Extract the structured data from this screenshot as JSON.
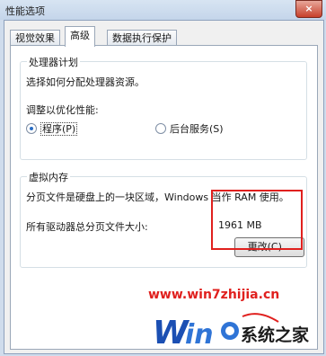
{
  "window": {
    "title": "性能选项",
    "close_glyph": "×"
  },
  "tabs": [
    {
      "label": "视觉效果",
      "active": false
    },
    {
      "label": "高级",
      "active": true
    },
    {
      "label": "数据执行保护",
      "active": false
    }
  ],
  "cpu_scheduling": {
    "legend": "处理器计划",
    "description": "选择如何分配处理器资源。",
    "adjust_label": "调整以优化性能:",
    "options": [
      {
        "label": "程序(P)",
        "selected": true
      },
      {
        "label": "后台服务(S)",
        "selected": false
      }
    ]
  },
  "virtual_memory": {
    "legend": "虚拟内存",
    "description": "分页文件是硬盘上的一块区域，Windows 当作 RAM 使用。",
    "total_label": "所有驱动器总分页文件大小:",
    "total_value": "1961 MB",
    "change_button": "更改(C)..."
  },
  "watermark": {
    "url": "www.win7zhijia.cn",
    "brand": "系统之家",
    "accent": "#e0201e"
  }
}
